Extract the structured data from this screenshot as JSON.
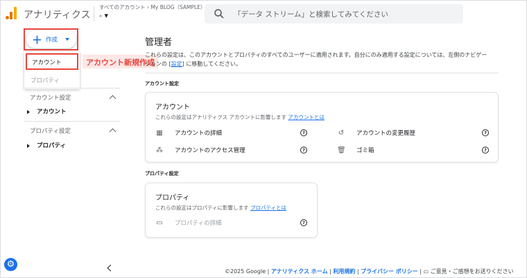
{
  "header": {
    "app_title": "アナリティクス",
    "account_crumb": "すべてのアカウント › My BLOG（SAMPLE）",
    "account_name": "- ▾",
    "search_placeholder": "「データ ストリーム」と検索してみてください"
  },
  "sidebar": {
    "create_label": "作成",
    "menu_account": "アカウント",
    "menu_property": "プロパティ",
    "callout": "アカウント新規作成",
    "account_settings_head": "アカウント設定",
    "account_item": "アカウント",
    "property_settings_head": "プロパティ設定",
    "property_item": "プロパティ"
  },
  "main": {
    "title": "管理者",
    "desc_line1": "これらの設定は、このアカウントとプロパティのすべてのユーザーに適用されます。自分にのみ適用する設定については、左側のナビゲー",
    "desc_line2_pre": "ションの [",
    "desc_link": "設定",
    "desc_line2_post": "] に移動してください。",
    "account_section_label": "アカウント設定",
    "account_card": {
      "title": "アカウント",
      "sub": "これらの設定はアナリティクス アカウントに影響します",
      "sub_link": "アカウントとは",
      "details": "アカウントの詳細",
      "access": "アカウントのアクセス管理",
      "history": "アカウントの変更履歴",
      "trash": "ゴミ箱"
    },
    "property_section_label": "プロパティ設定",
    "property_card": {
      "title": "プロパティ",
      "sub": "これらの設定はプロパティに影響します",
      "sub_link": "プロパティとは",
      "details": "プロパティの詳細"
    }
  },
  "footer": {
    "copyright": "©2025 Google | ",
    "home": "アナリティクス ホーム",
    "sep1": " | ",
    "terms": "利用規約",
    "sep2": " | ",
    "privacy": "プライバシー ポリシー",
    "sep3": " | ",
    "feedback": "ご意見・ご感想をお送りください"
  },
  "colors": {
    "accent": "#1a73e8",
    "highlight": "#e8453c",
    "logo": "#f9ab00"
  }
}
